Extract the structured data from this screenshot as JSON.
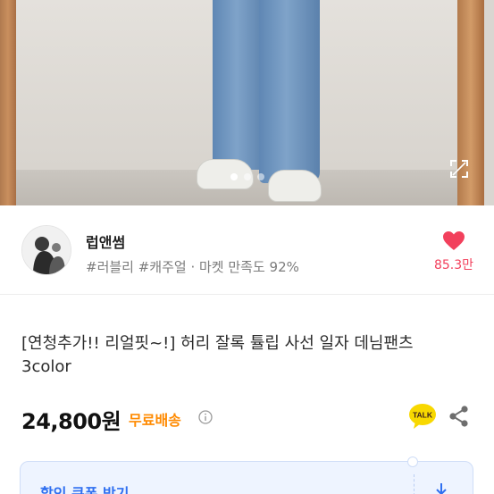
{
  "hero": {
    "image": "denim-pants-photo",
    "dots": 3,
    "active_dot": 1,
    "expand_icon": "expand-icon"
  },
  "seller": {
    "name": "럽앤썸",
    "tags": "#러블리 #캐주얼 · 마켓 만족도 92%",
    "like_icon": "heart-icon",
    "like_count": "85.3만",
    "accent": "#f2405c"
  },
  "product": {
    "title": "[연청추가!! 리얼핏~!] 허리 잘록 튤립 사선 일자 데님팬츠 3color",
    "price": "24,800원",
    "shipping": "무료배송",
    "shipping_color": "#ff8a00",
    "info_icon": "info-icon",
    "talk_label": "TALK",
    "share_icon": "share-icon"
  },
  "coupon": {
    "label": "할인 쿠폰 받기",
    "download_icon": "download-icon",
    "accent": "#2f6ff0"
  }
}
